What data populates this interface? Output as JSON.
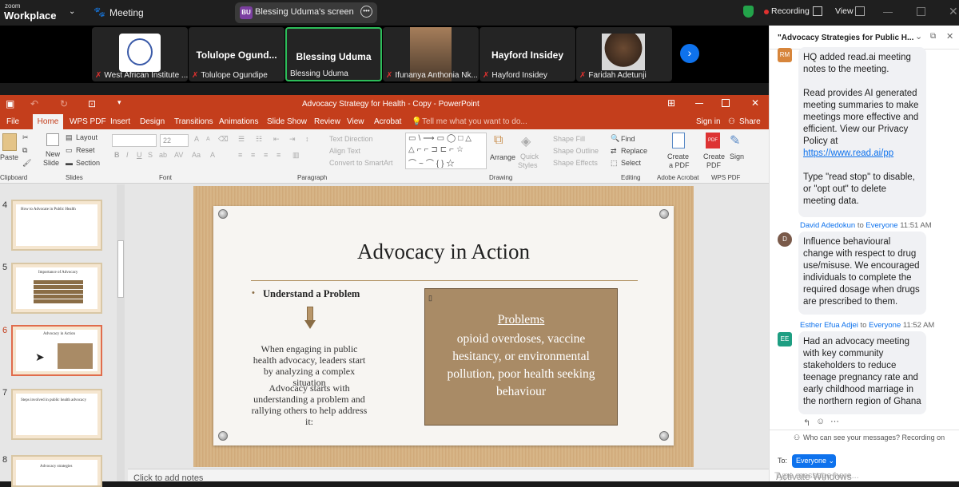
{
  "zoom": {
    "logo_top": "zoom",
    "logo_bottom": "Workplace",
    "meeting_label": "Meeting",
    "share_initials": "BU",
    "share_label": "Blessing Uduma's screen",
    "recording_label": "Recording",
    "view_label": "View"
  },
  "gallery": [
    {
      "name": "",
      "label": "West African Institute ..."
    },
    {
      "name": "Tolulope  Ogund...",
      "label": "Tolulope Ogundipe"
    },
    {
      "name": "Blessing Uduma",
      "label": "Blessing Uduma"
    },
    {
      "name": "",
      "label": "Ifunanya Anthonia Nk..."
    },
    {
      "name": "Hayford Insidey",
      "label": "Hayford Insidey"
    },
    {
      "name": "",
      "label": "Faridah Adetunji"
    }
  ],
  "ppt": {
    "window_title": "Advocacy Strategy for Health - Copy - PowerPoint",
    "menu": [
      "File",
      "Home",
      "WPS PDF",
      "Insert",
      "Design",
      "Transitions",
      "Animations",
      "Slide Show",
      "Review",
      "View",
      "Acrobat"
    ],
    "tell_me": "Tell me what you want to do...",
    "sign_in": "Sign in",
    "share": "Share",
    "ribbon": {
      "paste": "Paste",
      "clipboard": "Clipboard",
      "new_slide": "New",
      "new_slide2": "Slide",
      "layout": "Layout",
      "reset": "Reset",
      "section": "Section",
      "slides": "Slides",
      "font_size": "22",
      "font": "Font",
      "text_direction": "Text Direction",
      "align_text": "Align Text",
      "convert_smartart": "Convert to SmartArt",
      "paragraph": "Paragraph",
      "arrange": "Arrange",
      "quick_styles": "Quick",
      "quick_styles2": "Styles",
      "shape_fill": "Shape Fill",
      "shape_outline": "Shape Outline",
      "shape_effects": "Shape Effects",
      "drawing": "Drawing",
      "find": "Find",
      "replace": "Replace",
      "select": "Select",
      "editing": "Editing",
      "create_pdf": "Create",
      "create_pdf2": "a PDF",
      "adobe_acrobat": "Adobe Acrobat",
      "create_pdf3": "Create",
      "create_pdf4": "PDF",
      "sign": "Sign",
      "wps_pdf": "WPS PDF"
    },
    "thumbs": [
      {
        "num": "4",
        "title": "How to Advocate in Public Health"
      },
      {
        "num": "5",
        "title": "Importance of Advocacy"
      },
      {
        "num": "6",
        "title": "Advocacy in Action"
      },
      {
        "num": "7",
        "title": "Steps involved in public health advocacy"
      },
      {
        "num": "8",
        "title": "Advocacy strategies"
      }
    ],
    "slide": {
      "title": "Advocacy in Action",
      "bullet": "Understand a Problem",
      "para1": "When engaging in public health advocacy, leaders start by analyzing a complex situation",
      "para2": "Advocacy starts with understanding a problem and rallying others to help address it:",
      "box_heading": "Problems",
      "box_text": "opioid overdoses, vaccine hesitancy, or environmental pollution, poor health seeking behaviour"
    },
    "notes_placeholder": "Click to add notes"
  },
  "chat": {
    "title": "\"Advocacy Strategies for Public H...",
    "messages": [
      {
        "initials": "RM",
        "sender": "",
        "to": "",
        "recipient": "",
        "time": "",
        "lines": [
          "HQ added read.ai meeting notes to the meeting.",
          "Read provides AI generated meeting summaries to make meetings more effective and efficient. View our Privacy Policy at",
          "https://www.read.ai/pp",
          "Type \"read stop\" to disable, or \"opt out\" to delete meeting data."
        ]
      },
      {
        "initials": "D",
        "sender": "David Adedokun",
        "to": "to",
        "recipient": "Everyone",
        "time": "11:51 AM",
        "lines": [
          "Influence behavioural change with respect to drug use/misuse. We encouraged individuals to complete the required dosage when drugs are prescribed to them."
        ]
      },
      {
        "initials": "EE",
        "sender": "Esther Efua Adjei",
        "to": "to",
        "recipient": "Everyone",
        "time": "11:52 AM",
        "lines": [
          "Had an advocacy meeting with key community stakeholders to reduce teenage pregnancy rate and early childhood marriage in the northern region of Ghana"
        ]
      }
    ],
    "privacy": "Who can see your messages? Recording on",
    "to_label": "To:",
    "to_value": "Everyone",
    "input_placeholder": "Type message here...",
    "watermark": "Activate Windows"
  }
}
